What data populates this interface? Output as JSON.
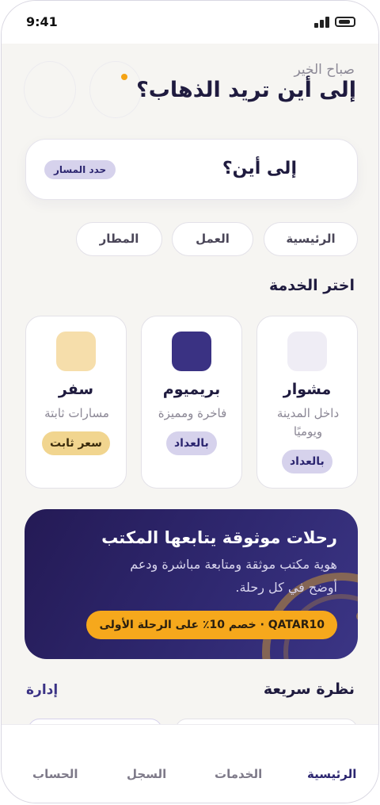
{
  "status_bar": {
    "time": "9:41",
    "icons": [
      "signal-icon",
      "battery-icon"
    ]
  },
  "header": {
    "greeting": "صباح الخير",
    "title": "إلى أين تريد الذهاب؟"
  },
  "search": {
    "title": "إلى أين؟",
    "route_button": "حدد المسار"
  },
  "quick_places": [
    {
      "label": "الرئيسية"
    },
    {
      "label": "العمل"
    },
    {
      "label": "المطار"
    }
  ],
  "services_section": {
    "title": "اختر الخدمة"
  },
  "services": [
    {
      "name": "مشوار",
      "description": "داخل المدينة ويوميًا",
      "badge": "بالعداد",
      "icon_color": "#efedf5"
    },
    {
      "name": "بريميوم",
      "description": "فاخرة ومميزة",
      "badge": "بالعداد",
      "icon_color": "#3a3283"
    },
    {
      "name": "سفر",
      "description": "مسارات ثابتة",
      "badge": "سعر ثابت",
      "icon_color": "#f6deab"
    }
  ],
  "promo": {
    "title": "رحلات موثوقة يتابعها المكتب",
    "body": "هوية مكتب موثقة ومتابعة مباشرة ودعم أوضح في كل رحلة.",
    "code": "QATAR10 · خصم 10٪ على الرحلة الأولى"
  },
  "overview": {
    "title": "نظرة سريعة",
    "manage": "إدارة"
  },
  "bottom_nav": [
    {
      "label": "الرئيسية",
      "active": true
    },
    {
      "label": "الخدمات",
      "active": false
    },
    {
      "label": "السجل",
      "active": false
    },
    {
      "label": "الحساب",
      "active": false
    }
  ],
  "colors": {
    "primary": "#2c2670",
    "accent": "#f6a81c",
    "background": "#f6f5f2"
  }
}
